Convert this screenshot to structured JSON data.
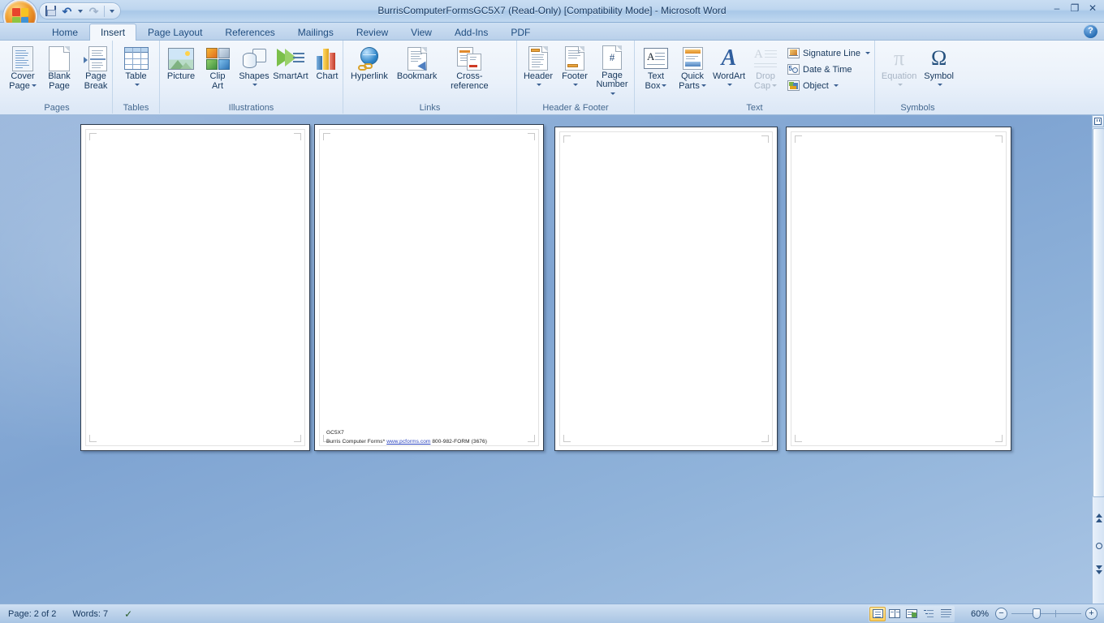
{
  "window": {
    "title": "BurrisComputerFormsGC5X7 (Read-Only) [Compatibility Mode] - Microsoft Word",
    "title_doc": "BurrisComputerFormsGC5X7 (Read-Only) [Compatibility Mode) ",
    "minimize_label": "–",
    "restore_label": "❐",
    "close_label": "✕",
    "help_label": "?"
  },
  "quick_access": {
    "office_button": "Office Button",
    "save_label": "Save",
    "undo_label": "Undo",
    "undo_caret": "▾",
    "redo_label": "Redo",
    "customize_caret": "▾"
  },
  "tabs": [
    {
      "label": "Home",
      "active": false
    },
    {
      "label": "Insert",
      "active": true
    },
    {
      "label": "Page Layout",
      "active": false
    },
    {
      "label": "References",
      "active": false
    },
    {
      "label": "Mailings",
      "active": false
    },
    {
      "label": "Review",
      "active": false
    },
    {
      "label": "View",
      "active": false
    },
    {
      "label": "Add-Ins",
      "active": false
    },
    {
      "label": "PDF",
      "active": false
    }
  ],
  "ribbon": {
    "groups": [
      {
        "name": "Pages",
        "label": "Pages",
        "buttons": [
          {
            "line1": "Cover",
            "line2": "Page",
            "caret": true
          },
          {
            "line1": "Blank",
            "line2": "Page",
            "caret": false
          },
          {
            "line1": "Page",
            "line2": "Break",
            "caret": false
          }
        ]
      },
      {
        "name": "Tables",
        "label": "Tables",
        "buttons": [
          {
            "line1": "Table",
            "line2": "",
            "caret": true
          }
        ]
      },
      {
        "name": "Illustrations",
        "label": "Illustrations",
        "buttons": [
          {
            "line1": "Picture",
            "line2": "",
            "caret": false
          },
          {
            "line1": "Clip",
            "line2": "Art",
            "caret": false
          },
          {
            "line1": "Shapes",
            "line2": "",
            "caret": true
          },
          {
            "line1": "SmartArt",
            "line2": "",
            "caret": false
          },
          {
            "line1": "Chart",
            "line2": "",
            "caret": false
          }
        ]
      },
      {
        "name": "Links",
        "label": "Links",
        "buttons": [
          {
            "line1": "Hyperlink",
            "line2": "",
            "caret": false
          },
          {
            "line1": "Bookmark",
            "line2": "",
            "caret": false
          },
          {
            "line1": "Cross-reference",
            "line2": "",
            "caret": false
          }
        ]
      },
      {
        "name": "Header & Footer",
        "label": "Header & Footer",
        "buttons": [
          {
            "line1": "Header",
            "line2": "",
            "caret": true
          },
          {
            "line1": "Footer",
            "line2": "",
            "caret": true
          },
          {
            "line1": "Page",
            "line2": "Number",
            "caret": true
          }
        ]
      },
      {
        "name": "Text",
        "label": "Text",
        "buttons": [
          {
            "line1": "Text",
            "line2": "Box",
            "caret": true
          },
          {
            "line1": "Quick",
            "line2": "Parts",
            "caret": true
          },
          {
            "line1": "WordArt",
            "line2": "",
            "caret": true
          },
          {
            "line1": "Drop",
            "line2": "Cap",
            "caret": true,
            "disabled": true
          }
        ],
        "small_buttons": [
          {
            "label": "Signature Line",
            "caret": true
          },
          {
            "label": "Date & Time",
            "caret": false
          },
          {
            "label": "Object",
            "caret": true
          }
        ]
      },
      {
        "name": "Symbols",
        "label": "Symbols",
        "buttons": [
          {
            "line1": "Equation",
            "line2": "",
            "caret": true,
            "disabled": true,
            "glyph": "π"
          },
          {
            "line1": "Symbol",
            "line2": "",
            "caret": true,
            "glyph": "Ω"
          }
        ]
      }
    ]
  },
  "document": {
    "page_count_visible": 4,
    "text_block": {
      "line1": "GC5X7",
      "line2_prefix": "Burris Computer Forms",
      "line2_mark": "*",
      "link": "www.pcforms.com",
      "line2_suffix": "800-982-FORM (3676)"
    }
  },
  "status_bar": {
    "page_label": "Page: 2 of 2",
    "words_label": "Words: 7",
    "proofing_icon": "spell-check-icon",
    "zoom_level": "60%",
    "zoom_out_label": "−",
    "zoom_in_label": "+",
    "view_buttons": [
      {
        "name": "print-layout",
        "active": true
      },
      {
        "name": "full-screen-reading",
        "active": false
      },
      {
        "name": "web-layout",
        "active": false
      },
      {
        "name": "outline",
        "active": false
      },
      {
        "name": "draft",
        "active": false
      }
    ]
  },
  "scrollbar": {
    "up_arrow": "▲",
    "previous_page": "previous-page",
    "browse_object": "select-browse-object",
    "next_page": "next-page"
  }
}
